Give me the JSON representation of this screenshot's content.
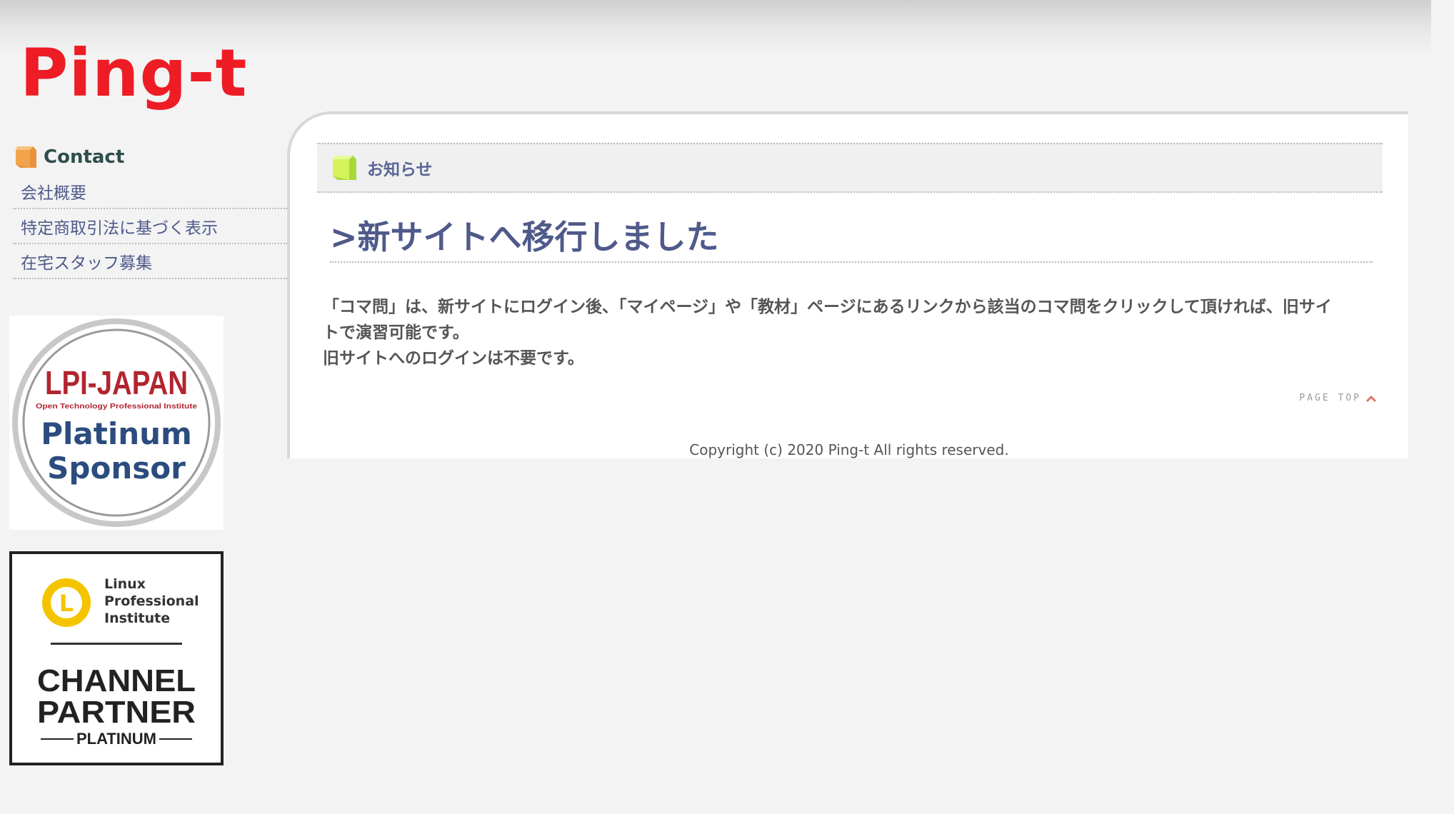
{
  "site": {
    "logo": "Ping-t"
  },
  "sidebar": {
    "heading": "Contact",
    "items": [
      {
        "label": "会社概要"
      },
      {
        "label": "特定商取引法に基づく表示"
      },
      {
        "label": "在宅スタッフ募集"
      }
    ]
  },
  "badges": {
    "lpij": {
      "title": "LPI-JAPAN",
      "subtitle": "Open Technology Professional Institute",
      "line1": "Platinum",
      "line2": "Sponsor"
    },
    "lpi": {
      "org_line1": "Linux",
      "org_line2": "Professional",
      "org_line3": "Institute",
      "line1": "CHANNEL",
      "line2": "PARTNER",
      "tier": "PLATINUM"
    }
  },
  "main": {
    "notice_label": "お知らせ",
    "title": ">新サイトへ移行しました",
    "body": [
      "「コマ問」は、新サイトにログイン後、「マイページ」や「教材」ページにあるリンクから該当のコマ問をクリックして頂ければ、旧サイ",
      "トで演習可能です。",
      "旧サイトへのログインは不要です。"
    ],
    "page_top": "PAGE TOP",
    "copyright": "Copyright (c) 2020 Ping-t All rights reserved."
  },
  "colors": {
    "logo": "#ee1c25",
    "link": "#4f5a8a",
    "heading": "#2d4e4b",
    "lpij_red": "#b2252f",
    "lpij_blue": "#2b4c7e",
    "lpi_yellow": "#f5c400"
  },
  "icons": {
    "contact_heading": "orange-cube-icon",
    "notice_heading": "green-cube-icon",
    "page_top": "chevron-up-icon"
  }
}
